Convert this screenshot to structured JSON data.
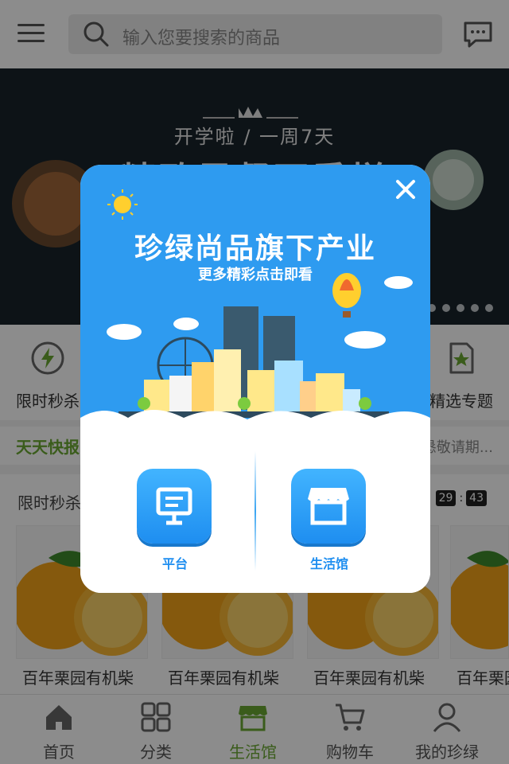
{
  "header": {
    "search_placeholder": "输入您要搜索的商品"
  },
  "banner": {
    "subtitle": "开学啦 / 一周7天",
    "title": "精致早餐不重样"
  },
  "quick_menu": [
    {
      "label": "限时秒杀",
      "icon": "lightning-icon"
    },
    {
      "label": "精选专题",
      "icon": "star-document-icon"
    }
  ],
  "news": {
    "tag": "天天快报",
    "text": "恳敬请期..."
  },
  "flash_sale": {
    "title": "限时秒杀",
    "timer": [
      "29",
      "43"
    ],
    "products": [
      {
        "name": "百年栗园有机柴"
      },
      {
        "name": "百年栗园有机柴"
      },
      {
        "name": "百年栗园有机柴"
      },
      {
        "name": "百年栗园有机柴"
      }
    ]
  },
  "bottom_nav": [
    {
      "label": "首页",
      "icon": "home-icon",
      "active": false
    },
    {
      "label": "分类",
      "icon": "grid-icon",
      "active": false
    },
    {
      "label": "生活馆",
      "icon": "store-icon",
      "active": true
    },
    {
      "label": "购物车",
      "icon": "cart-icon",
      "active": false
    },
    {
      "label": "我的珍绿",
      "icon": "user-icon",
      "active": false
    }
  ],
  "modal": {
    "title": "珍绿尚品旗下产业",
    "subtitle": "更多精彩点击即看",
    "buttons": [
      {
        "label": "平台",
        "icon": "monitor-icon"
      },
      {
        "label": "生活馆",
        "icon": "shop-icon"
      }
    ]
  },
  "colors": {
    "brand_green": "#6aa832",
    "modal_blue": "#2e9bf0",
    "button_blue": "#1e8ef0"
  }
}
